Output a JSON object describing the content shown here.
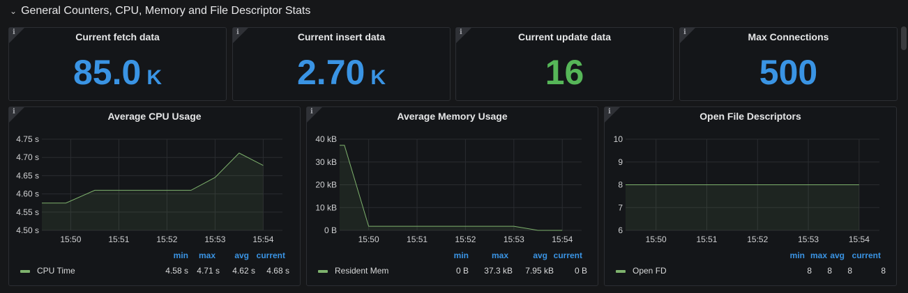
{
  "row": {
    "chevron": "⌄",
    "title": "General Counters, CPU, Memory and File Descriptor Stats"
  },
  "colors": {
    "accent_blue": "#3a94e4",
    "accent_green": "#56b658",
    "series_line": "#7eb26d",
    "background": "#161719"
  },
  "icons": {
    "panel_info": "info-icon",
    "row_toggle": "chevron-down-icon"
  },
  "info_glyph": "i",
  "stats": [
    {
      "title": "Current fetch data",
      "value": "85.0",
      "unit": "K",
      "color": "blue"
    },
    {
      "title": "Current insert data",
      "value": "2.70",
      "unit": "K",
      "color": "blue"
    },
    {
      "title": "Current update data",
      "value": "16",
      "unit": "",
      "color": "green"
    },
    {
      "title": "Max Connections",
      "value": "500",
      "unit": "",
      "color": "blue"
    }
  ],
  "graphs": [
    {
      "title": "Average CPU Usage",
      "legend_headers": [
        "min",
        "max",
        "avg",
        "current"
      ],
      "legend": {
        "name": "CPU Time",
        "min": "4.58 s",
        "max": "4.71 s",
        "avg": "4.62 s",
        "current": "4.68 s"
      }
    },
    {
      "title": "Average Memory Usage",
      "legend_headers": [
        "min",
        "max",
        "avg",
        "current"
      ],
      "legend": {
        "name": "Resident Mem",
        "min": "0 B",
        "max": "37.3 kB",
        "avg": "7.95 kB",
        "current": "0 B"
      }
    },
    {
      "title": "Open File Descriptors",
      "legend_headers": [
        "min",
        "max",
        "avg",
        "current"
      ],
      "legend": {
        "name": "Open FD",
        "min": "8",
        "max": "8",
        "avg": "8",
        "current": "8"
      }
    }
  ],
  "chart_data": [
    {
      "type": "area",
      "title": "Average CPU Usage",
      "x_tick_labels": [
        "15:50",
        "15:51",
        "15:52",
        "15:53",
        "15:54"
      ],
      "y_tick_labels": [
        "4.50 s",
        "4.55 s",
        "4.60 s",
        "4.65 s",
        "4.70 s",
        "4.75 s"
      ],
      "ylim": [
        4.5,
        4.75
      ],
      "xlim": [
        "15:49.4",
        "15:54.4"
      ],
      "grid": true,
      "legend_position": "bottom",
      "series": [
        {
          "name": "CPU Time",
          "x": [
            "15:49.4",
            "15:49.9",
            "15:50.5",
            "15:51.0",
            "15:52.0",
            "15:52.5",
            "15:53.0",
            "15:53.5",
            "15:54.0"
          ],
          "y": [
            4.575,
            4.575,
            4.61,
            4.61,
            4.61,
            4.61,
            4.645,
            4.712,
            4.678
          ]
        }
      ]
    },
    {
      "type": "area",
      "title": "Average Memory Usage",
      "x_tick_labels": [
        "15:50",
        "15:51",
        "15:52",
        "15:53",
        "15:54"
      ],
      "y_tick_labels": [
        "0 B",
        "10 kB",
        "20 kB",
        "30 kB",
        "40 kB"
      ],
      "ylim": [
        0,
        40
      ],
      "xlim": [
        "15:49.4",
        "15:54.4"
      ],
      "grid": true,
      "legend_position": "bottom",
      "series": [
        {
          "name": "Resident Mem",
          "x": [
            "15:49.4",
            "15:49.5",
            "15:50.0",
            "15:51.0",
            "15:52.0",
            "15:53.0",
            "15:53.5",
            "15:54.0"
          ],
          "y": [
            37.3,
            37.3,
            1.8,
            1.8,
            1.8,
            1.8,
            0,
            0
          ]
        }
      ]
    },
    {
      "type": "area",
      "title": "Open File Descriptors",
      "x_tick_labels": [
        "15:50",
        "15:51",
        "15:52",
        "15:53",
        "15:54"
      ],
      "y_tick_labels": [
        "6",
        "7",
        "8",
        "9",
        "10"
      ],
      "ylim": [
        6,
        10
      ],
      "xlim": [
        "15:49.4",
        "15:54.4"
      ],
      "grid": true,
      "legend_position": "bottom",
      "series": [
        {
          "name": "Open FD",
          "x": [
            "15:49.4",
            "15:54.0"
          ],
          "y": [
            8,
            8
          ]
        }
      ]
    }
  ]
}
